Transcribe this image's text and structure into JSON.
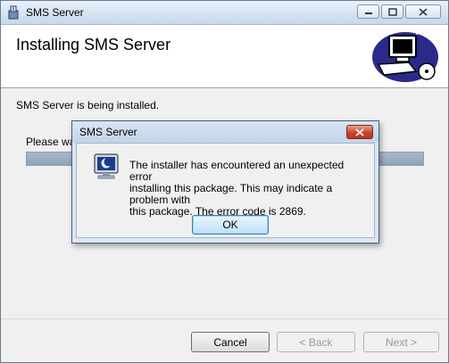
{
  "window": {
    "title": "SMS Server",
    "heading": "Installing SMS Server",
    "status_text": "SMS Server is being installed.",
    "wait_text": "Please wai",
    "progress": 1.0
  },
  "buttons": {
    "cancel": "Cancel",
    "back": "< Back",
    "next": "Next >"
  },
  "dialog": {
    "title": "SMS Server",
    "message": "The installer has encountered an unexpected error\ninstalling this package. This may indicate a problem with\nthis package. The error code is 2869.",
    "ok": "OK"
  },
  "icons": {
    "app": "installer-box-icon",
    "header": "computer-install-icon",
    "dialog": "monitor-moon-icon"
  }
}
